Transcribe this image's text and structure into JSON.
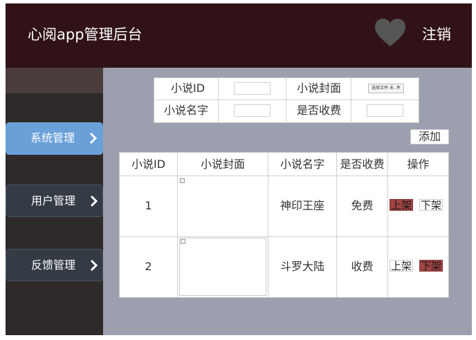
{
  "header": {
    "title": "心阅app管理后台",
    "logout_label": "注销",
    "icon": "heart-icon",
    "bg_color": "#311317"
  },
  "sidebar": {
    "items": [
      {
        "label": "系统管理",
        "active": true
      },
      {
        "label": "用户管理",
        "active": false
      },
      {
        "label": "反馈管理",
        "active": false
      }
    ],
    "active_color": "#6aa0d8"
  },
  "search_form": {
    "id_label": "小说ID",
    "cover_label": "小说封面",
    "name_label": "小说名字",
    "paid_label": "是否收费",
    "id_value": "",
    "name_value": "",
    "paid_value": "",
    "file_button": "选择文件 未..件"
  },
  "add_label": "添加",
  "table": {
    "headers": [
      "小说ID",
      "小说封面",
      "小说名字",
      "是否收费",
      "操作"
    ],
    "rows": [
      {
        "id": "1",
        "name": "神印王座",
        "paid": "免费",
        "on_label": "上架",
        "off_label": "下架",
        "active_action": "on"
      },
      {
        "id": "2",
        "name": "斗罗大陆",
        "paid": "收费",
        "on_label": "上架",
        "off_label": "下架",
        "active_action": "off"
      }
    ]
  },
  "colors": {
    "main_bg": "#9c9fae",
    "sidebar_bg": "#2f2a2a",
    "button_red": "#a04444"
  }
}
